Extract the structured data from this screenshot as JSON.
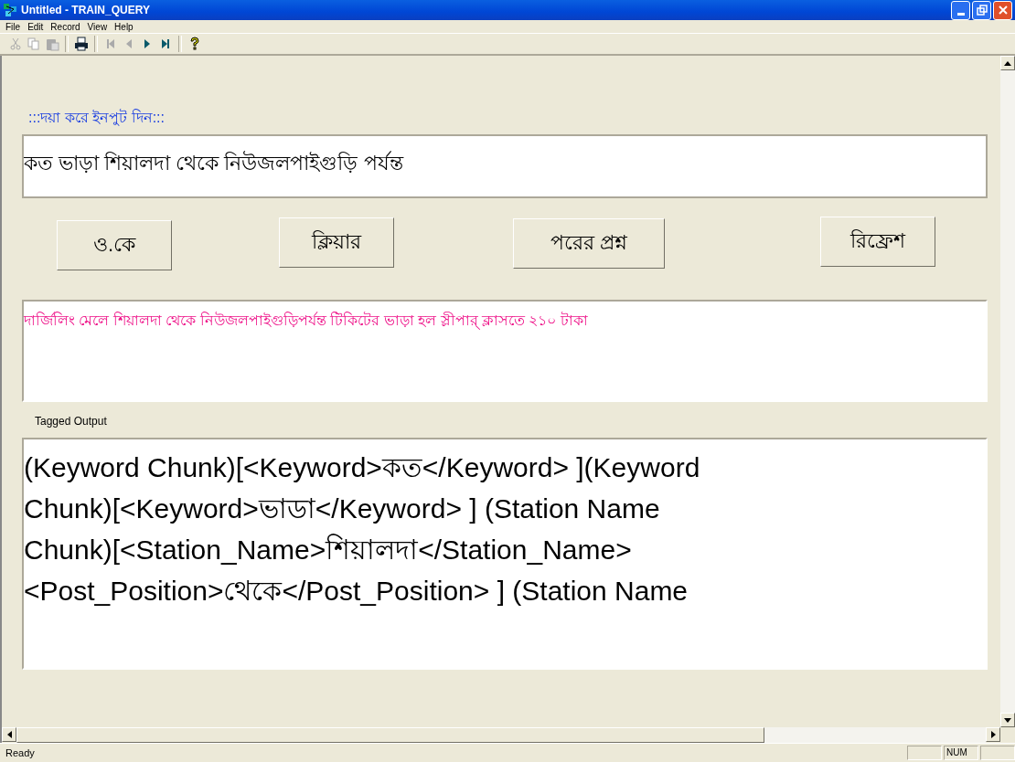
{
  "window": {
    "title": "Untitled - TRAIN_QUERY"
  },
  "menu": [
    "File",
    "Edit",
    "Record",
    "View",
    "Help"
  ],
  "toolbar": [
    {
      "kind": "cut",
      "disabled": true
    },
    {
      "kind": "copy",
      "disabled": true
    },
    {
      "kind": "paste",
      "disabled": true
    },
    {
      "kind": "sep"
    },
    {
      "kind": "print",
      "disabled": false
    },
    {
      "kind": "sep"
    },
    {
      "kind": "first",
      "disabled": true
    },
    {
      "kind": "prev",
      "disabled": true
    },
    {
      "kind": "next",
      "disabled": false
    },
    {
      "kind": "last",
      "disabled": false
    },
    {
      "kind": "sep"
    },
    {
      "kind": "help",
      "disabled": false
    }
  ],
  "prompt": ":::দয়া করে ইনপুট দিন:::",
  "query": {
    "value": "কত ভাড়া শিয়ালদা থেকে নিউজলপাইগুড়ি পর্যন্ত"
  },
  "buttons": [
    "ও.কে",
    "ক্লিয়ার",
    "পরের প্রশ্ন",
    "রিফ্রেশ"
  ],
  "answer": "দার্জিলিং মেলে শিয়ালদা থেকে নিউজলপাইগুড়িপর্যন্ত টিকিটের ভাড়া হল স্লীপার্ ক্লাসতে ২১০ টাকা",
  "tagged_output": {
    "label": "Tagged Output",
    "text": "(Keyword Chunk)[<Keyword>কত</Keyword> ](Keyword Chunk)[<Keyword>ভাডা</Keyword> ] (Station Name Chunk)[<Station_Name>শিয়ালদা</Station_Name> <Post_Position>থেকে</Post_Position> ] (Station Name"
  },
  "status_bar": {
    "text": "Ready",
    "indicators": [
      "NUM"
    ]
  }
}
